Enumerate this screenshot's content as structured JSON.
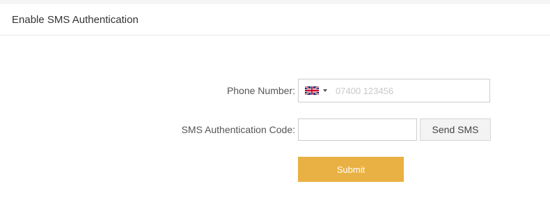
{
  "page": {
    "title": "Enable SMS Authentication"
  },
  "form": {
    "phone": {
      "label": "Phone Number:",
      "country_flag_icon": "uk-flag-icon",
      "placeholder": "07400 123456",
      "value": ""
    },
    "sms_code": {
      "label": "SMS Authentication Code:",
      "value": "",
      "send_label": "Send SMS"
    },
    "submit_label": "Submit"
  },
  "colors": {
    "submit_bg": "#e9b143",
    "border": "#cccccc",
    "send_bg": "#f3f3f3"
  }
}
